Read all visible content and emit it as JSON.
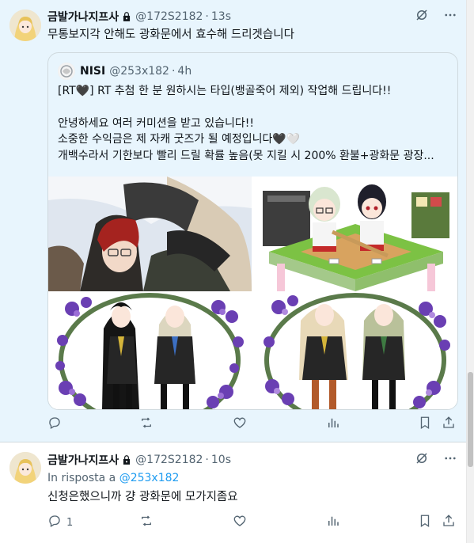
{
  "tweet1": {
    "name": "금발가나지프사",
    "handle": "@172S2182",
    "time": "13s",
    "text": "무통보지각 안해도 광화문에서 효수해 드리겟습니다",
    "quote": {
      "name": "NISI",
      "handle": "@253x182",
      "time": "4h",
      "line1": "[RT🖤] RT 추첨 한 분 원하시는 타입(뱅골죽어 제외) 작업해 드립니다!!",
      "line2": "안녕하세요 여러 커미션을 받고 있습니다!!",
      "line3": "소중한 수익금은 제 자캐 굿즈가 될 예정입니다🖤🤍",
      "line4": "개백수라서 기한보다 빨리 드릴 확률 높음(못 지킬 시 200% 환불+광화문 광장..."
    },
    "actions": {
      "reply_count": "",
      "repost_count": "",
      "like_count": ""
    }
  },
  "tweet2": {
    "name": "금발가나지프사",
    "handle": "@172S2182",
    "time": "10s",
    "reply_prefix": "In risposta a",
    "reply_to": "@253x182",
    "text": "신청은했으니까 걍 광화문에 모가지좀요",
    "actions": {
      "reply_count": "1"
    }
  },
  "icons": [
    "lock-icon",
    "grok-icon",
    "more-icon",
    "reply-icon",
    "repost-icon",
    "like-icon",
    "views-icon",
    "bookmark-icon",
    "share-icon"
  ],
  "colors": {
    "selected_bg": "#e8f5fd",
    "link": "#1d9bf0",
    "muted": "#536471",
    "border": "#cfd9de"
  }
}
